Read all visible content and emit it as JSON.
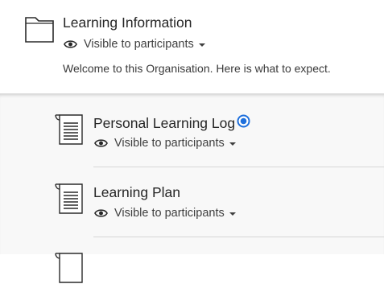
{
  "folder": {
    "title": "Learning Information",
    "visibility": "Visible to participants",
    "description": "Welcome to this Organisation. Here is what to expect."
  },
  "items": [
    {
      "title": "Personal Learning Log",
      "visibility": "Visible to participants",
      "badge_icon": "new-activity-icon"
    },
    {
      "title": "Learning Plan",
      "visibility": "Visible to participants"
    }
  ],
  "colors": {
    "badge": "#1e6fdc",
    "content_bg": "#f8f8f8",
    "text": "#262626"
  }
}
